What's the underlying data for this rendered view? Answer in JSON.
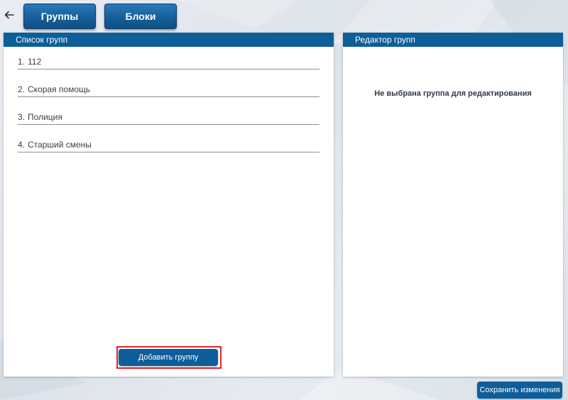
{
  "toolbar": {
    "back_icon": "arrow-left-icon",
    "groups_label": "Группы",
    "blocks_label": "Блоки"
  },
  "group_list_panel": {
    "title": "Список групп",
    "items": [
      {
        "number": "1.",
        "name": "112"
      },
      {
        "number": "2.",
        "name": "Скорая помощь"
      },
      {
        "number": "3.",
        "name": "Полиция"
      },
      {
        "number": "4.",
        "name": "Старший смены"
      }
    ],
    "add_button_label": "Добавить группу"
  },
  "group_editor_panel": {
    "title": "Редактор групп",
    "empty_message": "Не выбрана группа для редактирования"
  },
  "footer": {
    "save_button_label": "Сохранить изменения"
  },
  "colors": {
    "accent": "#0e5e9a",
    "highlight_frame": "#e0232b"
  }
}
